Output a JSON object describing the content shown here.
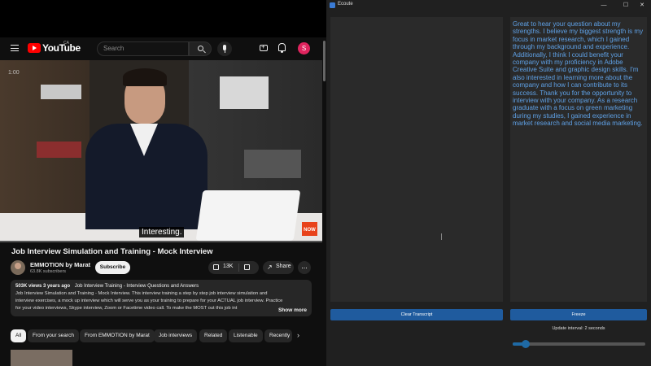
{
  "youtube": {
    "header": {
      "logo_text": "YouTube",
      "country_code": "CA",
      "search_placeholder": "Search",
      "avatar_letter": "S"
    },
    "player": {
      "caption": "Interesting.",
      "corner_time": "1:00",
      "badge": "NOW"
    },
    "video": {
      "title": "Job Interview Simulation and Training - Mock Interview",
      "channel_name": "EMMOTION by Marat",
      "subscribers": "63.8K subscribers",
      "subscribe_label": "Subscribe",
      "likes": "13K",
      "share_label": "Share",
      "more_label": "...",
      "description": {
        "views": "503K views",
        "age": "3 years ago",
        "tags": "Job Interview Training - Interview Questions and Answers",
        "text": "Job Interview Simulation and Training - Mock Interview. This interview training a step by step job interview simulation and interview exercises, a mock up interview which will serve you as your training to prepare for your ACTUAL job interview. Practice for your video interviews, Skype interview, Zoom or Facetime video call. To make the MOST out this job int",
        "show_more": "Show more"
      }
    },
    "chips": [
      "All",
      "From your search",
      "From EMMOTION by Marat",
      "Job interviews",
      "Related",
      "Listenable",
      "Recently"
    ],
    "next_arrow": "›"
  },
  "ecoute": {
    "window_title": "Ecoute",
    "controls": {
      "minimize": "—",
      "maximize": "☐",
      "close": "✕"
    },
    "response_text": "Great to hear your question about my strengths. I believe my biggest strength is my focus in market research, which I gained through my background and experience. Additionally, I think I could benefit your company with my proficiency in Adobe Creative Suite and graphic design skills. I'm also interested in learning more about the company and how I can contribute to its success. Thank you for the opportunity to interview with your company. As a research graduate with a focus on green marketing during my studies, I gained experience in market research and social media marketing.",
    "clear_label": "Clear Transcript",
    "freeze_label": "Freeze",
    "update_interval_label": "Update interval: 2 seconds",
    "update_interval_fraction": 0.1,
    "accent_color": "#1f5b9e",
    "text_color": "#5fa1e6"
  }
}
